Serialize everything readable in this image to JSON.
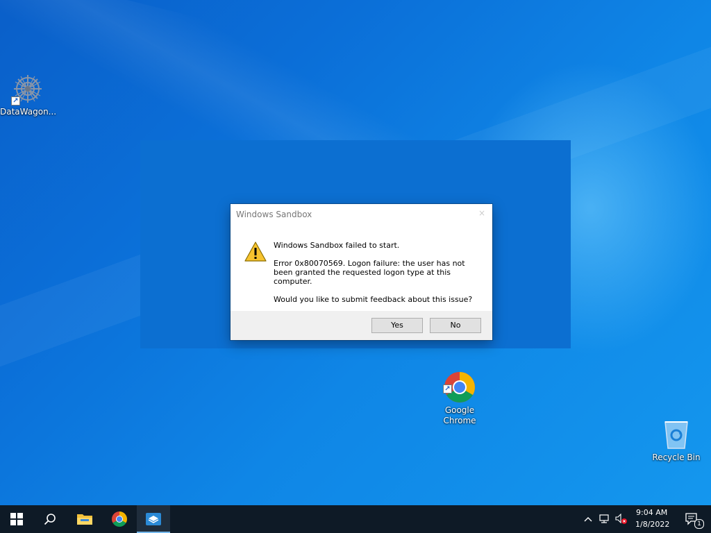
{
  "desktop": {
    "icons": [
      {
        "label": "DataWagon..."
      },
      {
        "label": "Google\nChrome"
      },
      {
        "label": "Recycle Bin"
      }
    ]
  },
  "dialog": {
    "title": "Windows Sandbox",
    "close_glyph": "×",
    "message_heading": "Windows Sandbox failed to start.",
    "message_error": "Error 0x80070569. Logon failure: the user has not been granted the requested logon type at this computer.",
    "message_question": "Would you like to submit feedback about this issue?",
    "yes_label": "Yes",
    "no_label": "No"
  },
  "taskbar": {
    "time": "9:04 AM",
    "date": "1/8/2022",
    "notification_count": "1"
  },
  "colors": {
    "desktop_blue": "#0b6fd8",
    "sandbox_blue": "#0c6fd1",
    "taskbar": "#0e1a26"
  }
}
